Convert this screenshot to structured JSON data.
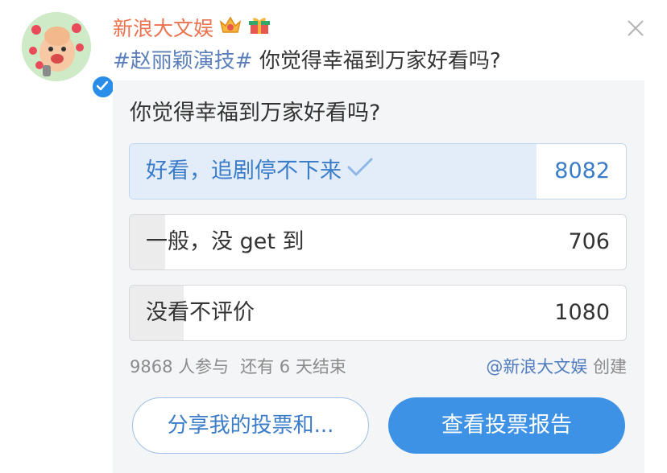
{
  "post": {
    "author": "新浪大文娱",
    "hashtag": "#赵丽颖演技#",
    "text": " 你觉得幸福到万家好看吗?"
  },
  "poll": {
    "question": "你觉得幸福到万家好看吗?",
    "options": [
      {
        "label": "好看，追剧停不下来",
        "count": "8082",
        "share": 0.819,
        "selected": true
      },
      {
        "label": "一般，没 get 到",
        "count": "706",
        "share": 0.072,
        "selected": false
      },
      {
        "label": "没看不评价",
        "count": "1080",
        "share": 0.109,
        "selected": false
      }
    ],
    "participants": "9868 人参与",
    "remaining": "还有 6 天结束",
    "creator_name": "@新浪大文娱",
    "creator_suffix": " 创建",
    "share_button": "分享我的投票和...",
    "report_button": "查看投票报告"
  },
  "colors": {
    "author": "#eb7350",
    "hashtag": "#5b7fb8",
    "selected_fill": "#e2edf9",
    "primary_button": "#3e92e6"
  },
  "icons": [
    "avatar",
    "verified-icon",
    "crown-badge-icon",
    "gift-badge-icon",
    "close-icon",
    "checkmark-icon"
  ]
}
